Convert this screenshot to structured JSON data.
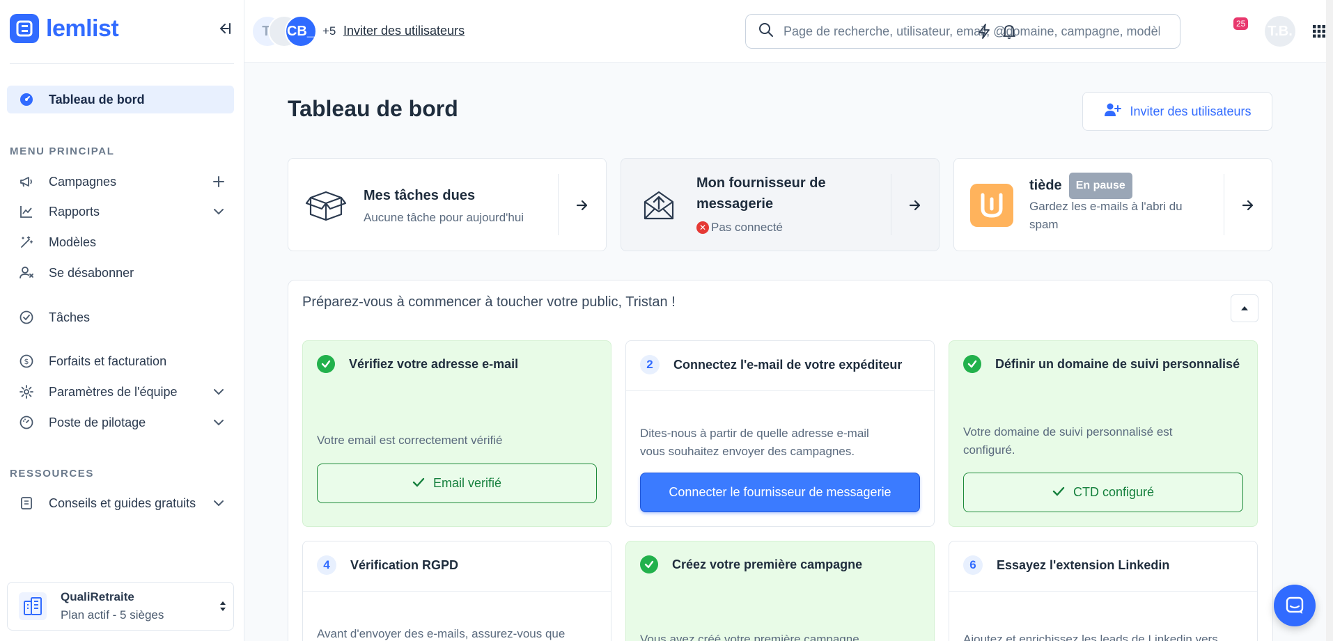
{
  "sidebar": {
    "brand": "lemlist",
    "active_item": "Tableau de bord",
    "section_main": "MENU PRINCIPAL",
    "main_items": [
      "Campagnes",
      "Rapports",
      "Modèles",
      "Se désabonner",
      "Tâches",
      "Forfaits et facturation",
      "Paramètres de l'équipe",
      "Poste de pilotage"
    ],
    "section_resources": "RESSOURCES",
    "resources_item": "Conseils et guides gratuits",
    "workspace": {
      "name": "QualiRetraite",
      "plan": "Plan actif - 5 sièges"
    }
  },
  "topbar": {
    "avatar_initials": [
      "T.",
      "",
      "CB_"
    ],
    "avatar_more": "+5",
    "invite_link": "Inviter des utilisateurs",
    "search_placeholder": "Page de recherche, utilisateur, email, @domaine, campagne, modèle",
    "notif_count": "25",
    "user_initials": "T.B."
  },
  "main": {
    "title": "Tableau de bord",
    "invite_button": "Inviter des utilisateurs",
    "cards": {
      "tasks": {
        "title": "Mes tâches dues",
        "subtitle": "Aucune tâche pour aujourd'hui"
      },
      "provider": {
        "title_line1": "Mon fournisseur de",
        "title_line2": "messagerie",
        "status": "Pas connecté"
      },
      "warmup": {
        "title": "tiède",
        "badge": "En pause",
        "subtitle_line1": "Gardez les e-mails à l'abri du",
        "subtitle_line2": "spam"
      }
    },
    "onboarding": {
      "title": "Préparez-vous à commencer à toucher votre public, Tristan !",
      "steps": [
        {
          "title": "Vérifiez votre adresse e-mail",
          "desc": "Votre email est correctement vérifié",
          "button": "Email verifié"
        },
        {
          "number": "2",
          "title": "Connectez l'e-mail de votre expéditeur",
          "desc_line1": "Dites-nous à partir de quelle adresse e-mail",
          "desc_line2": "vous souhaitez envoyer des campagnes.",
          "button": "Connecter le fournisseur de messagerie"
        },
        {
          "title": "Définir un domaine de suivi personnalisé",
          "desc_line1": "Votre domaine de suivi personnalisé est",
          "desc_line2": "configuré.",
          "button": "CTD configuré"
        },
        {
          "number": "4",
          "title": "Vérification RGPD",
          "desc": "Avant d'envoyer des e-mails, assurez-vous que"
        },
        {
          "title": "Créez votre première campagne",
          "desc": "Vous avez créé votre première campagne"
        },
        {
          "number": "6",
          "title": "Essayez l'extension Linkedin",
          "desc": "Ajoutez et enrichissez les leads de Linkedin vers"
        }
      ]
    }
  },
  "colors": {
    "accent": "#316bff",
    "success": "#22b14c",
    "error": "#e53935",
    "done_bg": "#e8fbe7"
  }
}
